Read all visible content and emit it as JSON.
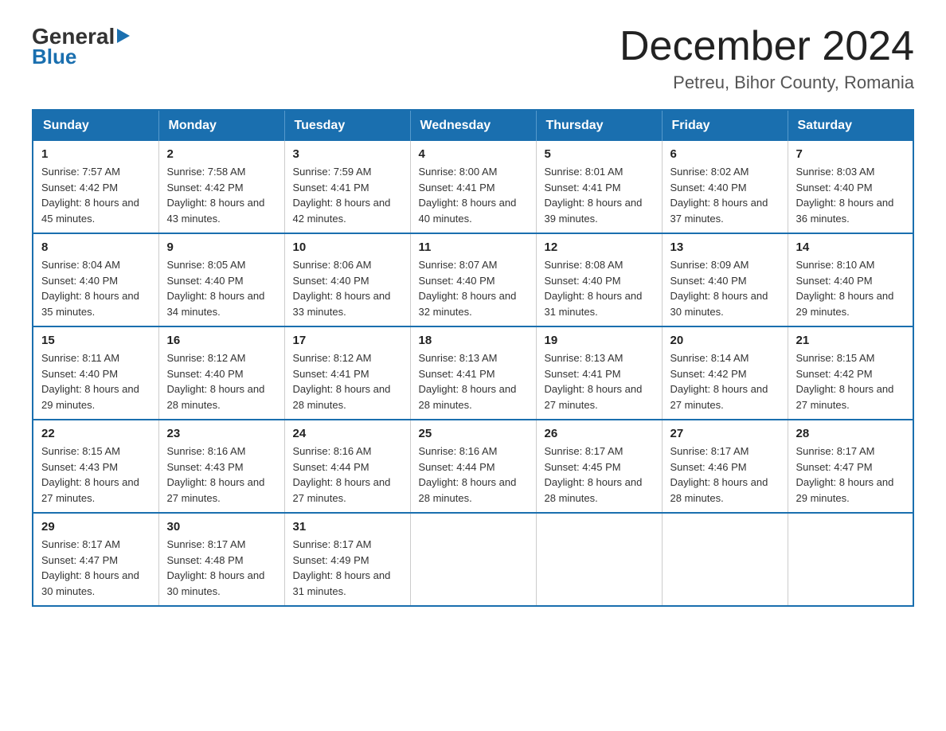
{
  "header": {
    "logo_general": "General",
    "logo_blue": "Blue",
    "title": "December 2024",
    "subtitle": "Petreu, Bihor County, Romania"
  },
  "calendar": {
    "days_of_week": [
      "Sunday",
      "Monday",
      "Tuesday",
      "Wednesday",
      "Thursday",
      "Friday",
      "Saturday"
    ],
    "weeks": [
      [
        {
          "day": "1",
          "sunrise": "7:57 AM",
          "sunset": "4:42 PM",
          "daylight": "8 hours and 45 minutes."
        },
        {
          "day": "2",
          "sunrise": "7:58 AM",
          "sunset": "4:42 PM",
          "daylight": "8 hours and 43 minutes."
        },
        {
          "day": "3",
          "sunrise": "7:59 AM",
          "sunset": "4:41 PM",
          "daylight": "8 hours and 42 minutes."
        },
        {
          "day": "4",
          "sunrise": "8:00 AM",
          "sunset": "4:41 PM",
          "daylight": "8 hours and 40 minutes."
        },
        {
          "day": "5",
          "sunrise": "8:01 AM",
          "sunset": "4:41 PM",
          "daylight": "8 hours and 39 minutes."
        },
        {
          "day": "6",
          "sunrise": "8:02 AM",
          "sunset": "4:40 PM",
          "daylight": "8 hours and 37 minutes."
        },
        {
          "day": "7",
          "sunrise": "8:03 AM",
          "sunset": "4:40 PM",
          "daylight": "8 hours and 36 minutes."
        }
      ],
      [
        {
          "day": "8",
          "sunrise": "8:04 AM",
          "sunset": "4:40 PM",
          "daylight": "8 hours and 35 minutes."
        },
        {
          "day": "9",
          "sunrise": "8:05 AM",
          "sunset": "4:40 PM",
          "daylight": "8 hours and 34 minutes."
        },
        {
          "day": "10",
          "sunrise": "8:06 AM",
          "sunset": "4:40 PM",
          "daylight": "8 hours and 33 minutes."
        },
        {
          "day": "11",
          "sunrise": "8:07 AM",
          "sunset": "4:40 PM",
          "daylight": "8 hours and 32 minutes."
        },
        {
          "day": "12",
          "sunrise": "8:08 AM",
          "sunset": "4:40 PM",
          "daylight": "8 hours and 31 minutes."
        },
        {
          "day": "13",
          "sunrise": "8:09 AM",
          "sunset": "4:40 PM",
          "daylight": "8 hours and 30 minutes."
        },
        {
          "day": "14",
          "sunrise": "8:10 AM",
          "sunset": "4:40 PM",
          "daylight": "8 hours and 29 minutes."
        }
      ],
      [
        {
          "day": "15",
          "sunrise": "8:11 AM",
          "sunset": "4:40 PM",
          "daylight": "8 hours and 29 minutes."
        },
        {
          "day": "16",
          "sunrise": "8:12 AM",
          "sunset": "4:40 PM",
          "daylight": "8 hours and 28 minutes."
        },
        {
          "day": "17",
          "sunrise": "8:12 AM",
          "sunset": "4:41 PM",
          "daylight": "8 hours and 28 minutes."
        },
        {
          "day": "18",
          "sunrise": "8:13 AM",
          "sunset": "4:41 PM",
          "daylight": "8 hours and 28 minutes."
        },
        {
          "day": "19",
          "sunrise": "8:13 AM",
          "sunset": "4:41 PM",
          "daylight": "8 hours and 27 minutes."
        },
        {
          "day": "20",
          "sunrise": "8:14 AM",
          "sunset": "4:42 PM",
          "daylight": "8 hours and 27 minutes."
        },
        {
          "day": "21",
          "sunrise": "8:15 AM",
          "sunset": "4:42 PM",
          "daylight": "8 hours and 27 minutes."
        }
      ],
      [
        {
          "day": "22",
          "sunrise": "8:15 AM",
          "sunset": "4:43 PM",
          "daylight": "8 hours and 27 minutes."
        },
        {
          "day": "23",
          "sunrise": "8:16 AM",
          "sunset": "4:43 PM",
          "daylight": "8 hours and 27 minutes."
        },
        {
          "day": "24",
          "sunrise": "8:16 AM",
          "sunset": "4:44 PM",
          "daylight": "8 hours and 27 minutes."
        },
        {
          "day": "25",
          "sunrise": "8:16 AM",
          "sunset": "4:44 PM",
          "daylight": "8 hours and 28 minutes."
        },
        {
          "day": "26",
          "sunrise": "8:17 AM",
          "sunset": "4:45 PM",
          "daylight": "8 hours and 28 minutes."
        },
        {
          "day": "27",
          "sunrise": "8:17 AM",
          "sunset": "4:46 PM",
          "daylight": "8 hours and 28 minutes."
        },
        {
          "day": "28",
          "sunrise": "8:17 AM",
          "sunset": "4:47 PM",
          "daylight": "8 hours and 29 minutes."
        }
      ],
      [
        {
          "day": "29",
          "sunrise": "8:17 AM",
          "sunset": "4:47 PM",
          "daylight": "8 hours and 30 minutes."
        },
        {
          "day": "30",
          "sunrise": "8:17 AM",
          "sunset": "4:48 PM",
          "daylight": "8 hours and 30 minutes."
        },
        {
          "day": "31",
          "sunrise": "8:17 AM",
          "sunset": "4:49 PM",
          "daylight": "8 hours and 31 minutes."
        },
        null,
        null,
        null,
        null
      ]
    ]
  }
}
